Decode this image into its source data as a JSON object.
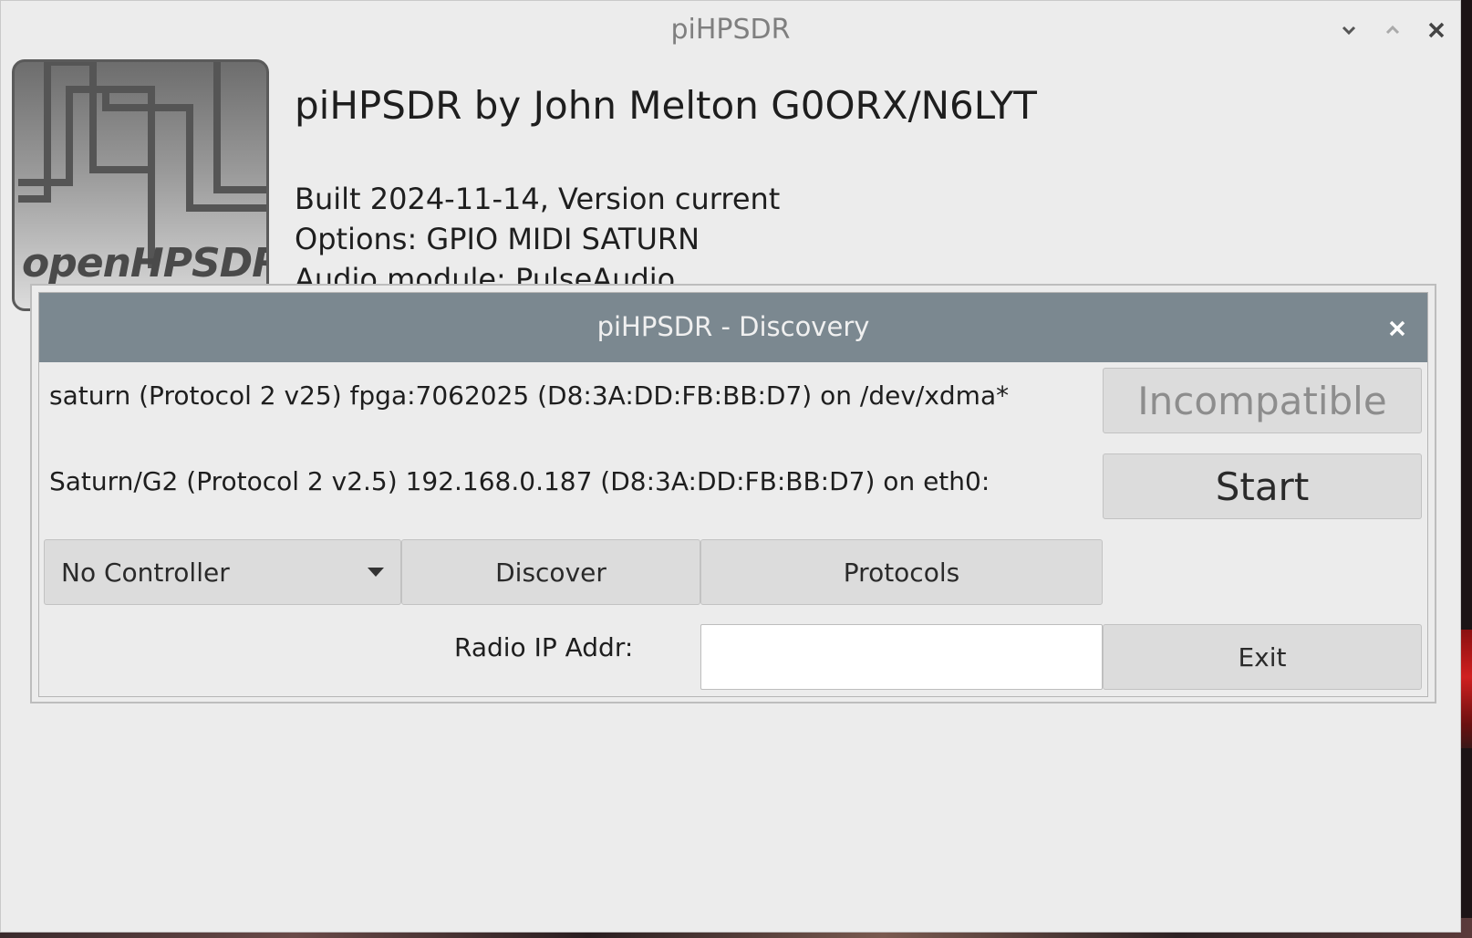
{
  "window": {
    "title": "piHPSDR",
    "controls": {
      "minimize_icon": "chevron-down-icon",
      "maximize_icon": "chevron-up-icon",
      "close_icon": "close-icon"
    }
  },
  "about": {
    "logo_text": "openHPSDR",
    "heading": "piHPSDR by John Melton G0ORX/N6LYT",
    "lines": [
      "Built 2024-11-14, Version current",
      "Options: GPIO MIDI SATURN",
      "Audio module: PulseAudio"
    ]
  },
  "discovery": {
    "title": "piHPSDR - Discovery",
    "radios": [
      {
        "description": "saturn (Protocol 2 v25) fpga:7062025 (D8:3A:DD:FB:BB:D7) on /dev/xdma*",
        "action": "Incompatible",
        "enabled": false
      },
      {
        "description": "Saturn/G2 (Protocol 2 v2.5) 192.168.0.187 (D8:3A:DD:FB:BB:D7) on eth0:",
        "action": "Start",
        "enabled": true
      }
    ],
    "controller": {
      "selected": "No Controller"
    },
    "discover_label": "Discover",
    "protocols_label": "Protocols",
    "ip_label": "Radio IP Addr:",
    "ip_value": "",
    "exit_label": "Exit"
  },
  "colors": {
    "dialog_titlebar": "#7b8890",
    "window_bg": "#ececec",
    "button_bg": "#dcdcdc"
  }
}
